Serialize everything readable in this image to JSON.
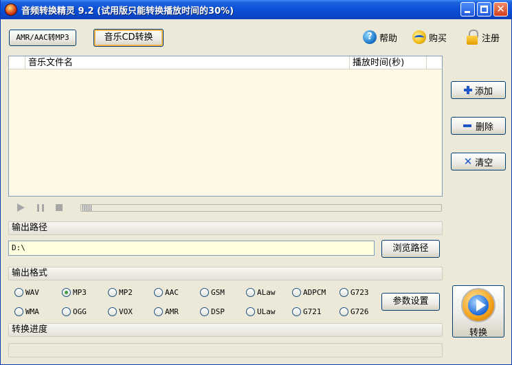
{
  "window": {
    "title": "音频转换精灵 9.2 (试用版只能转换播放时间的30%)",
    "minimize_glyph": "",
    "maximize_glyph": "",
    "close_glyph": "✕"
  },
  "toolbar": {
    "amr_button": "AMR/AAC转MP3",
    "cd_button": "音乐CD转换",
    "help": "帮助",
    "buy": "购买",
    "register": "注册"
  },
  "file_list": {
    "columns": [
      "音乐文件名",
      "播放时间(秒)"
    ],
    "rows": []
  },
  "side_buttons": {
    "add": "添加",
    "delete": "删除",
    "clear": "清空"
  },
  "output_path": {
    "label": "输出路径",
    "value": "D:\\",
    "browse": "浏览路径"
  },
  "output_format": {
    "label": "输出格式",
    "row1": [
      "WAV",
      "MP3",
      "MP2",
      "AAC",
      "GSM",
      "ALaw",
      "ADPCM",
      "G723"
    ],
    "row2": [
      "WMA",
      "OGG",
      "VOX",
      "AMR",
      "DSP",
      "ULaw",
      "G721",
      "G726"
    ],
    "selected": "MP3",
    "params": "参数设置"
  },
  "progress": {
    "label": "转换进度",
    "value": 0
  },
  "convert": {
    "label": "转换"
  },
  "colors": {
    "titlebar": "#0a4fd6",
    "list_bg": "#fdf7e6",
    "path_bg": "#ffffe0",
    "accent_icon": "#1d56c7"
  }
}
